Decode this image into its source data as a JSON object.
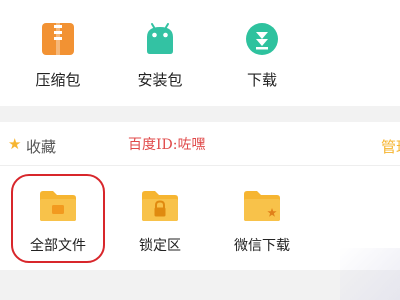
{
  "categories": [
    {
      "label": "压缩包",
      "icon": "archive-icon",
      "color": "#f29233"
    },
    {
      "label": "安装包",
      "icon": "android-icon",
      "color": "#33c2a3"
    },
    {
      "label": "下载",
      "icon": "download-icon",
      "color": "#2ec29e"
    }
  ],
  "favorites": {
    "star": "★",
    "title": "收藏",
    "manage_label": "管理",
    "accent_color": "#f6b531",
    "items": [
      {
        "label": "全部文件",
        "icon": "folder-icon"
      },
      {
        "label": "锁定区",
        "icon": "lock-folder-icon"
      },
      {
        "label": "微信下载",
        "icon": "wechat-download-folder-icon"
      }
    ]
  },
  "watermark": {
    "text": "百度ID:咗嘿",
    "color": "#e04a4a"
  },
  "highlight_color": "#d8262b"
}
